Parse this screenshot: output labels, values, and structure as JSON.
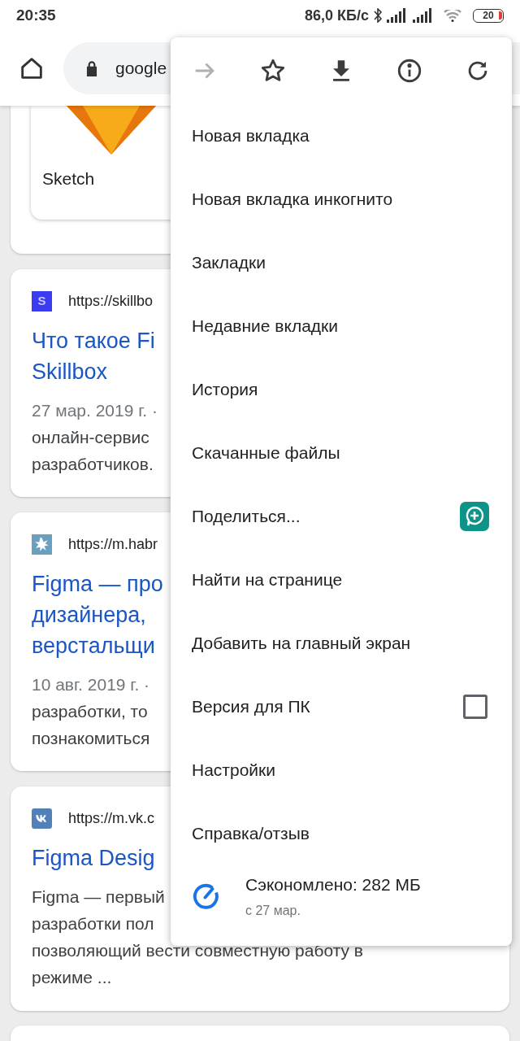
{
  "status_bar": {
    "time": "20:35",
    "speed": "86,0 КБ/с",
    "battery": "20"
  },
  "toolbar": {
    "url": "google"
  },
  "results": [
    {
      "kind": "app",
      "label": "Sketch"
    },
    {
      "kind": "result",
      "favicon": {
        "kind": "letter",
        "text": "S"
      },
      "url": "https://skillbo",
      "title_lines": [
        "Что такое Fi",
        "Skillbox"
      ],
      "date": "27 мар. 2019 г. ·",
      "body_lines": [
        "онлайн-сервис",
        "разработчиков."
      ]
    },
    {
      "kind": "result",
      "favicon": {
        "kind": "splash"
      },
      "url": "https://m.habr",
      "title_lines": [
        "Figma — про",
        "дизайнера,",
        "верстальщи"
      ],
      "date": "10 авг. 2019 г. ·",
      "body_lines": [
        "разработки, то",
        "познакомиться"
      ]
    },
    {
      "kind": "result",
      "favicon": {
        "kind": "vk"
      },
      "url": "https://m.vk.c",
      "title_lines": [
        "Figma Desig"
      ],
      "body_lines": [
        "Figma — первый",
        "разработки пол",
        "позволяющий вести совместную работу в",
        "режиме ..."
      ]
    }
  ],
  "menu": {
    "icons": [
      {
        "kind": "forward",
        "disabled": true
      },
      {
        "kind": "star",
        "disabled": false
      },
      {
        "kind": "download",
        "disabled": false
      },
      {
        "kind": "info",
        "disabled": false
      },
      {
        "kind": "reload",
        "disabled": false
      }
    ],
    "items": [
      {
        "kind": "plain",
        "label": "Новая вкладка"
      },
      {
        "kind": "plain",
        "label": "Новая вкладка инкогнито"
      },
      {
        "kind": "plain",
        "label": "Закладки"
      },
      {
        "kind": "plain",
        "label": "Недавние вкладки"
      },
      {
        "kind": "plain",
        "label": "История"
      },
      {
        "kind": "plain",
        "label": "Скачанные файлы"
      },
      {
        "kind": "share",
        "label": "Поделиться..."
      },
      {
        "kind": "plain",
        "label": "Найти на странице"
      },
      {
        "kind": "plain",
        "label": "Добавить на главный экран"
      },
      {
        "kind": "checkbox",
        "label": "Версия для ПК",
        "checked": false
      },
      {
        "kind": "plain",
        "label": "Настройки"
      },
      {
        "kind": "plain",
        "label": "Справка/отзыв"
      }
    ],
    "footer": {
      "title": "Сэкономлено: 282 МБ",
      "subtitle": "с 27 мар."
    }
  }
}
